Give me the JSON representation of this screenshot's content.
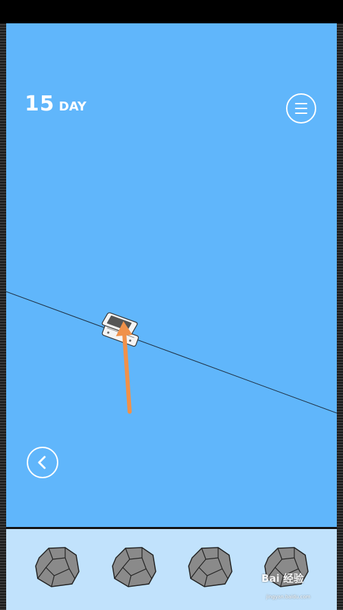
{
  "hud": {
    "day_number": "15",
    "day_label": "DAY"
  },
  "icons": {
    "menu": "hamburger-menu-icon",
    "back": "chevron-left-icon",
    "scene_item": "handheld-console-icon",
    "hint": "orange-arrow-icon",
    "inventory_item": "rock-icon"
  },
  "colors": {
    "sky": "#60b6fb",
    "inventory_bg": "#c1e2fc",
    "arrow": "#f0914a",
    "rock": "#8a8a8a"
  },
  "inventory": {
    "slots": [
      "rock",
      "rock",
      "rock",
      "rock"
    ]
  },
  "watermark": {
    "text": "Bai 经验",
    "sub": "jingyan.baidu.com"
  }
}
